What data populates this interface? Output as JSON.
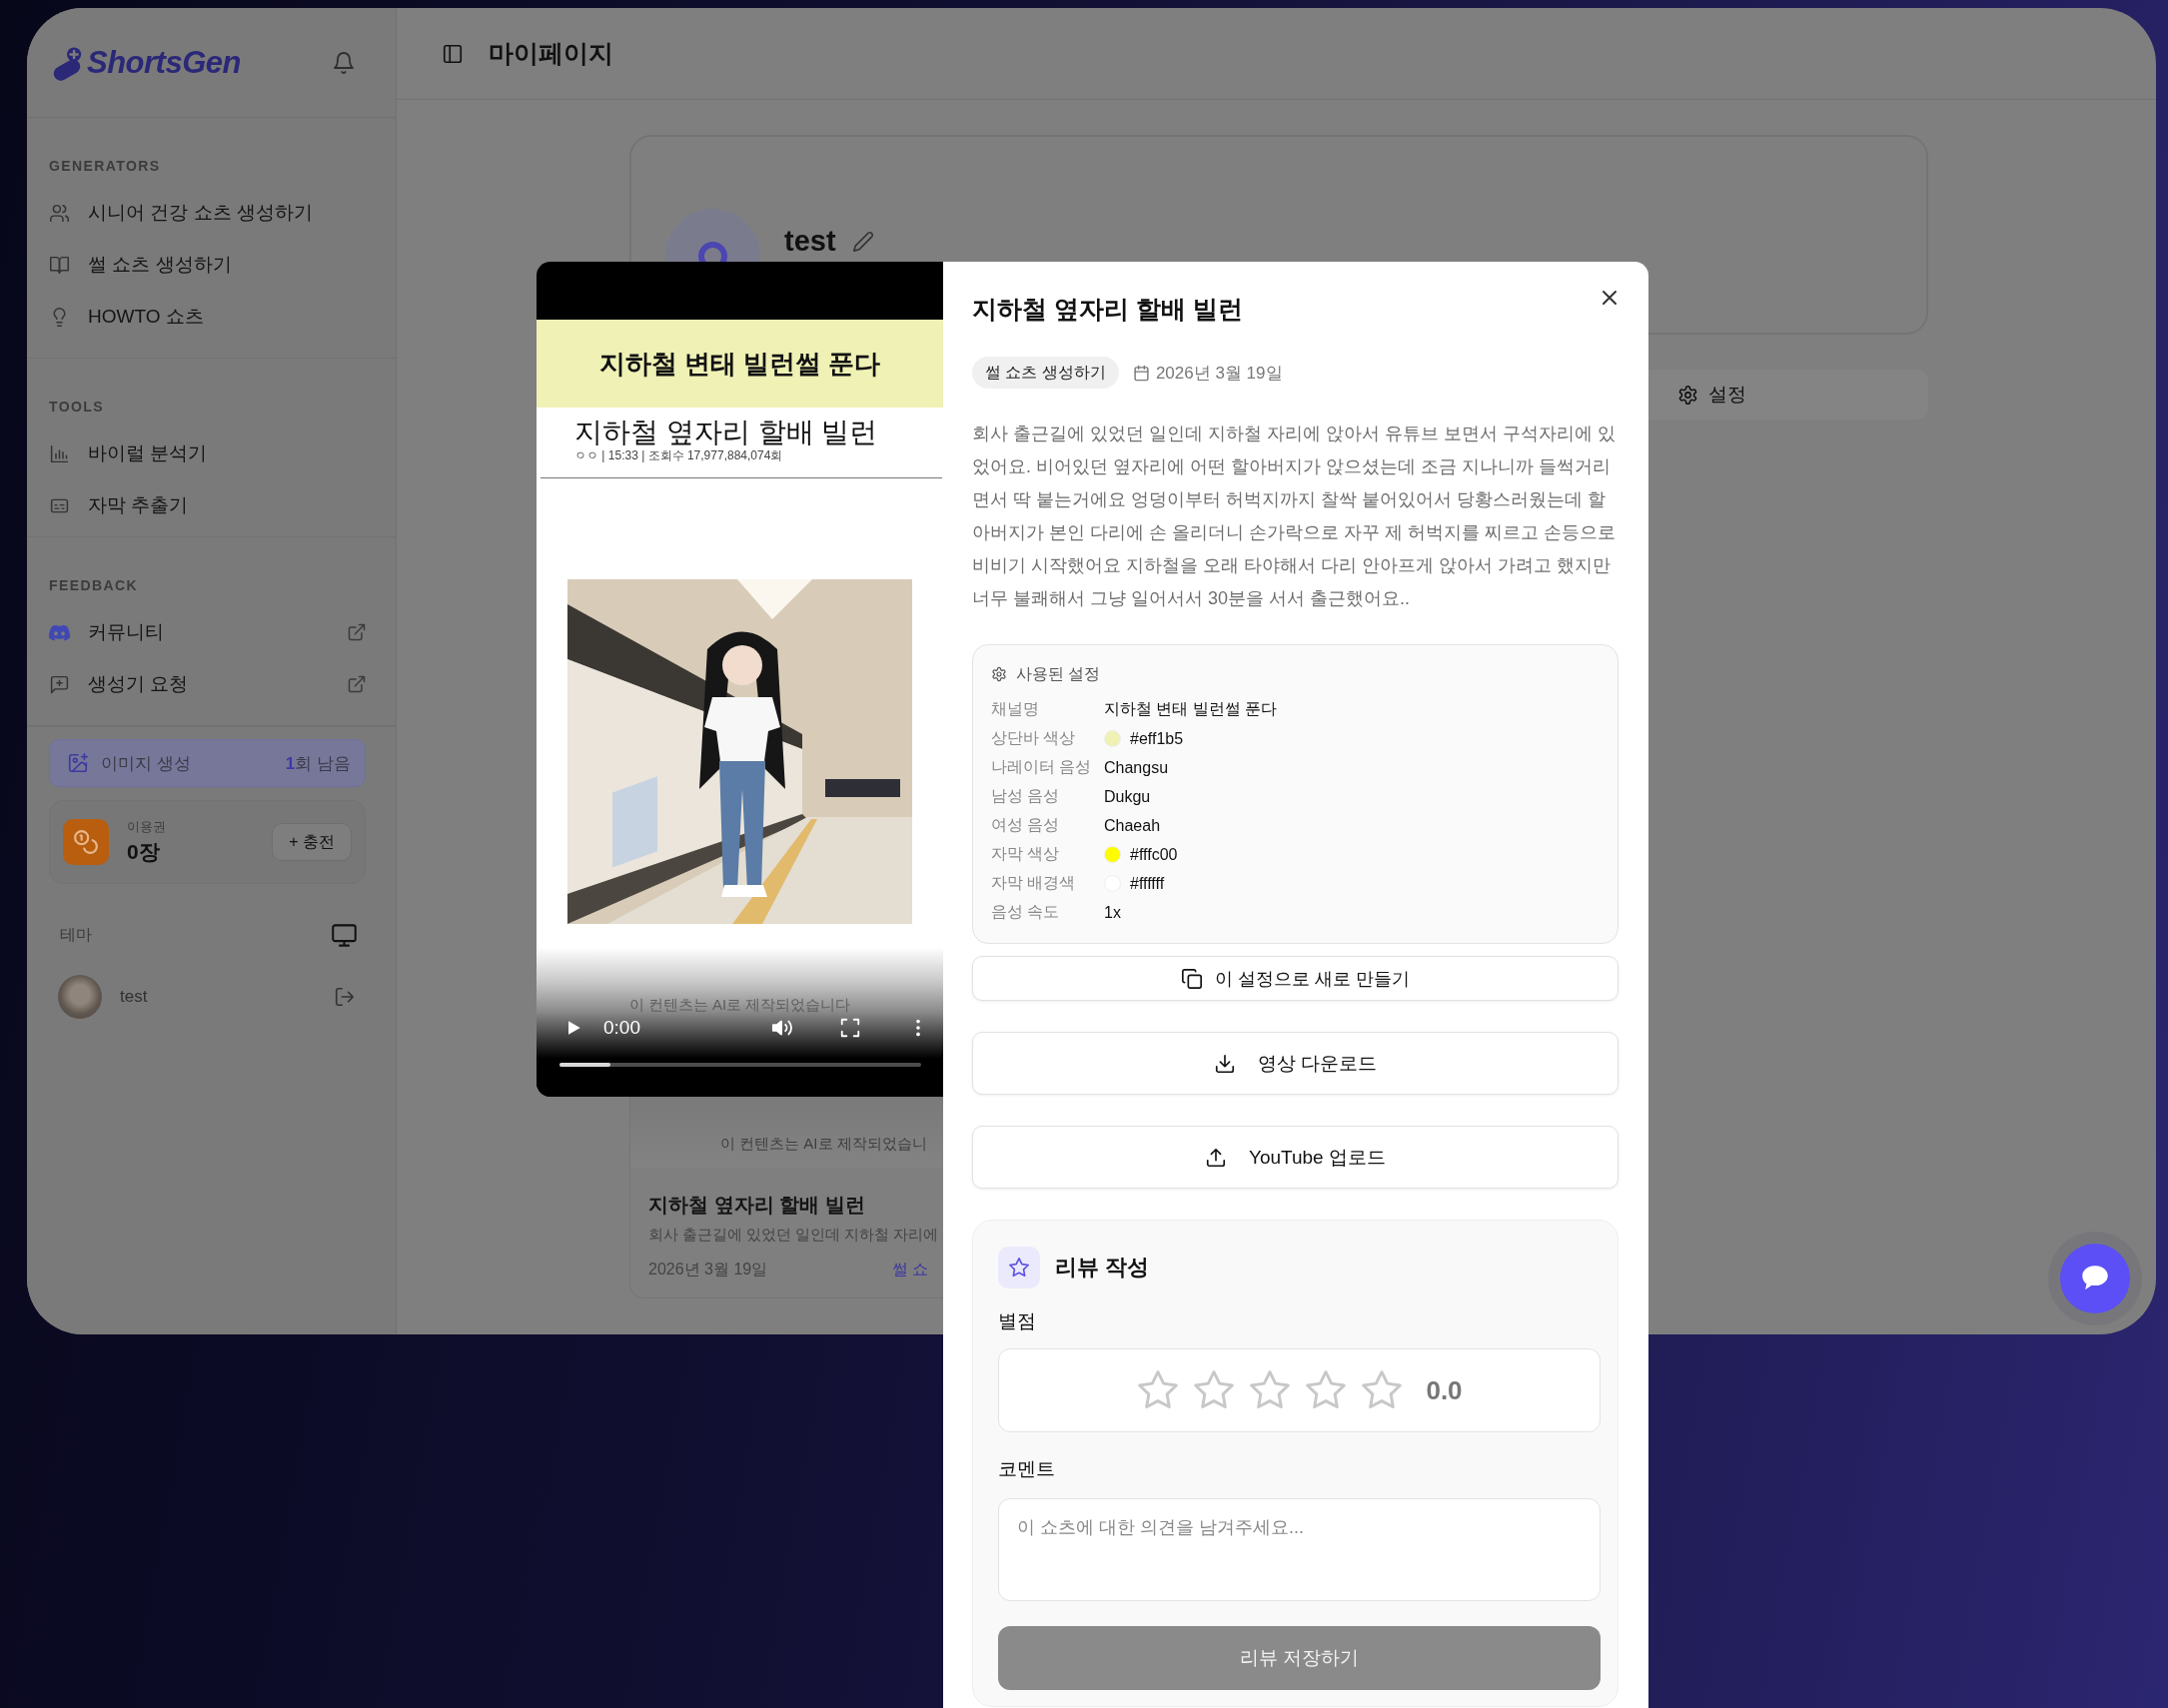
{
  "sidebar": {
    "logo": "ShortsGen",
    "sections": [
      {
        "heading": "GENERATORS",
        "items": [
          {
            "label": "시니어 건강 쇼츠 생성하기",
            "external": false
          },
          {
            "label": "썰 쇼츠 생성하기",
            "external": false
          },
          {
            "label": "HOWTO 쇼츠",
            "external": false
          }
        ]
      },
      {
        "heading": "TOOLS",
        "items": [
          {
            "label": "바이럴 분석기",
            "external": false
          },
          {
            "label": "자막 추출기",
            "external": false
          }
        ]
      },
      {
        "heading": "FEEDBACK",
        "items": [
          {
            "label": "커뮤니티",
            "external": true
          },
          {
            "label": "생성기 요청",
            "external": true
          }
        ]
      }
    ],
    "image_generation": {
      "label": "이미지 생성",
      "remaining": "**1**회 남음"
    },
    "credits": {
      "label": "이용권",
      "value": "0장",
      "button": "+ 충전"
    },
    "theme": {
      "label": "테마"
    },
    "user": {
      "name": "test"
    }
  },
  "page": {
    "title": "마이페이지",
    "profile": {
      "name": "test"
    },
    "settings_tab": "설정",
    "card": {
      "caption": "이 컨텐츠는 AI로 제작되었습니",
      "title": "지하철 옆자리 할배 빌런",
      "excerpt": "회사 출근길에 있었던 일인데 지하철 자리에",
      "date": "2026년 3월 19일",
      "tag": "썰 쇼"
    }
  },
  "modal": {
    "video": {
      "banner": "지하철 변태 빌런썰 푼다",
      "headline": "지하철 옆자리 할배 빌런",
      "meta": "ㅇㅇ | 15:33 | 조회수 17,977,884,074회",
      "caption": "이 컨텐츠는 AI로 제작되었습니다",
      "time": "0:00",
      "level": 0.14
    },
    "title": "지하철 옆자리 할배 빌런",
    "tag": "썰 쇼츠 생성하기",
    "date": "2026년 3월 19일",
    "description": "회사 출근길에 있었던 일인데 지하철 자리에 앉아서 유튜브 보면서 구석자리에 있었어요. 비어있던 옆자리에 어떤 할아버지가 앉으셨는데 조금 지나니까 들썩거리면서 딱 붙는거에요 엉덩이부터 허벅지까지 찰싹 붙어있어서 당황스러웠는데 할아버지가 본인 다리에 손 올리더니 손가락으로 자꾸 제 허벅지를 찌르고 손등으로 비비기 시작했어요 지하철을 오래 타야해서 다리 안아프게 앉아서 가려고 했지만 너무 불쾌해서 그냥 일어서서 30분을 서서 출근했어요..",
    "settings": {
      "heading": "사용된 설정",
      "rows": [
        {
          "kind": "text",
          "label": "채널명",
          "value": "지하철 변태 빌런썰 푼다"
        },
        {
          "kind": "color",
          "label": "상단바 색상",
          "value": "#eff1b5",
          "color": "#eff1b5"
        },
        {
          "kind": "text",
          "label": "나레이터 음성",
          "value": "Changsu"
        },
        {
          "kind": "text",
          "label": "남성 음성",
          "value": "Dukgu"
        },
        {
          "kind": "text",
          "label": "여성 음성",
          "value": "Chaeah"
        },
        {
          "kind": "color",
          "label": "자막 색상",
          "value": "#fffc00",
          "color": "#fffc00"
        },
        {
          "kind": "color",
          "label": "자막 배경색",
          "value": "#ffffff",
          "color": "#ffffff"
        },
        {
          "kind": "text",
          "label": "음성 속도",
          "value": "1x"
        }
      ]
    },
    "actions": [
      {
        "label": "이 설정으로 새로 만들기"
      },
      {
        "label": "영상 다운로드"
      },
      {
        "label": "YouTube 업로드"
      }
    ],
    "review": {
      "heading": "리뷰 작성",
      "rating_label": "별점",
      "stars": 0,
      "score": "0.0",
      "comment_label": "코멘트",
      "placeholder": "이 쇼츠에 대한 의견을 남겨주세요...",
      "submit": {
        "label": "리뷰 저장하기",
        "disabled": true
      }
    }
  }
}
